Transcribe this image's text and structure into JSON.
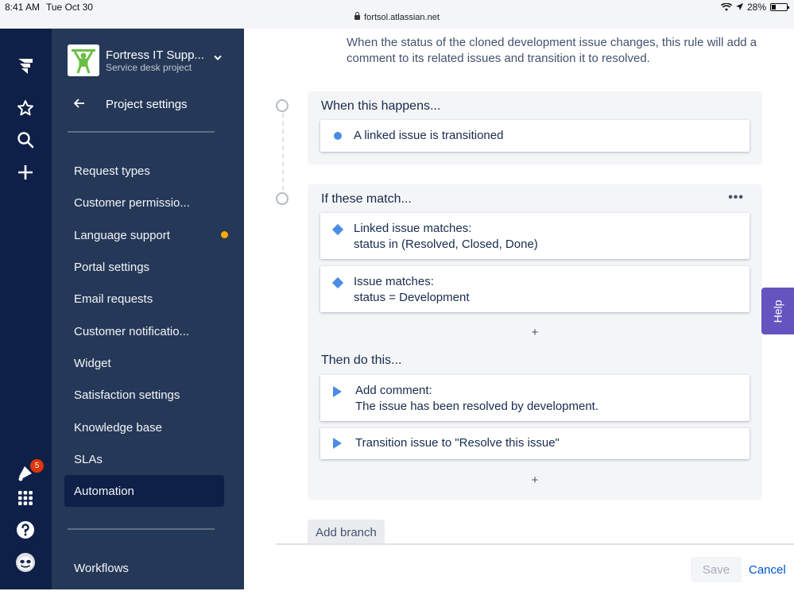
{
  "status_bar": {
    "time": "8:41 AM",
    "date": "Tue Oct 30",
    "url": "fortsol.atlassian.net",
    "battery": "28%",
    "battery_level": 0.28
  },
  "global_nav": {
    "icons": [
      "jira-logo-icon",
      "star-icon",
      "search-icon",
      "plus-icon",
      "notification-icon",
      "app-switcher-icon",
      "help-icon",
      "profile-avatar-icon"
    ],
    "notification_count": "5"
  },
  "sidebar": {
    "project_name": "Fortress IT Supp...",
    "project_type": "Service desk project",
    "back_label": "Project settings",
    "items": [
      {
        "label": "Request types"
      },
      {
        "label": "Customer permissio..."
      },
      {
        "label": "Language support",
        "has_dot": true
      },
      {
        "label": "Portal settings"
      },
      {
        "label": "Email requests"
      },
      {
        "label": "Customer notificatio..."
      },
      {
        "label": "Widget"
      },
      {
        "label": "Satisfaction settings"
      },
      {
        "label": "Knowledge base"
      },
      {
        "label": "SLAs"
      },
      {
        "label": "Automation",
        "active": true
      }
    ],
    "bottom_item": "Workflows"
  },
  "main": {
    "description": "When the status of the cloned development issue changes, this rule will add a comment to its related issues and transition it to resolved.",
    "when": {
      "title": "When this happens...",
      "trigger": "A linked issue is transitioned"
    },
    "if": {
      "title": "If these match...",
      "more": "•••",
      "conditions": [
        {
          "line1": "Linked issue matches:",
          "line2": "status in (Resolved, Closed, Done)"
        },
        {
          "line1": "Issue matches:",
          "line2": "status = Development"
        }
      ],
      "add": "+"
    },
    "then": {
      "title": "Then do this...",
      "actions": [
        {
          "line1": "Add comment:",
          "line2": "The issue has been resolved by development."
        },
        {
          "line1": "Transition issue to \"Resolve this issue\"",
          "line2": ""
        }
      ],
      "add": "+"
    },
    "add_branch_label": "Add branch",
    "save_label": "Save",
    "cancel_label": "Cancel",
    "help_label": "Help"
  },
  "colors": {
    "global_nav_bg": "#0e2047",
    "sidebar_bg": "#253858",
    "accent": "#4c8ce4",
    "link": "#0052cc",
    "help_tab": "#6554c0",
    "badge": "#de350b",
    "dot": "#ffab00"
  }
}
